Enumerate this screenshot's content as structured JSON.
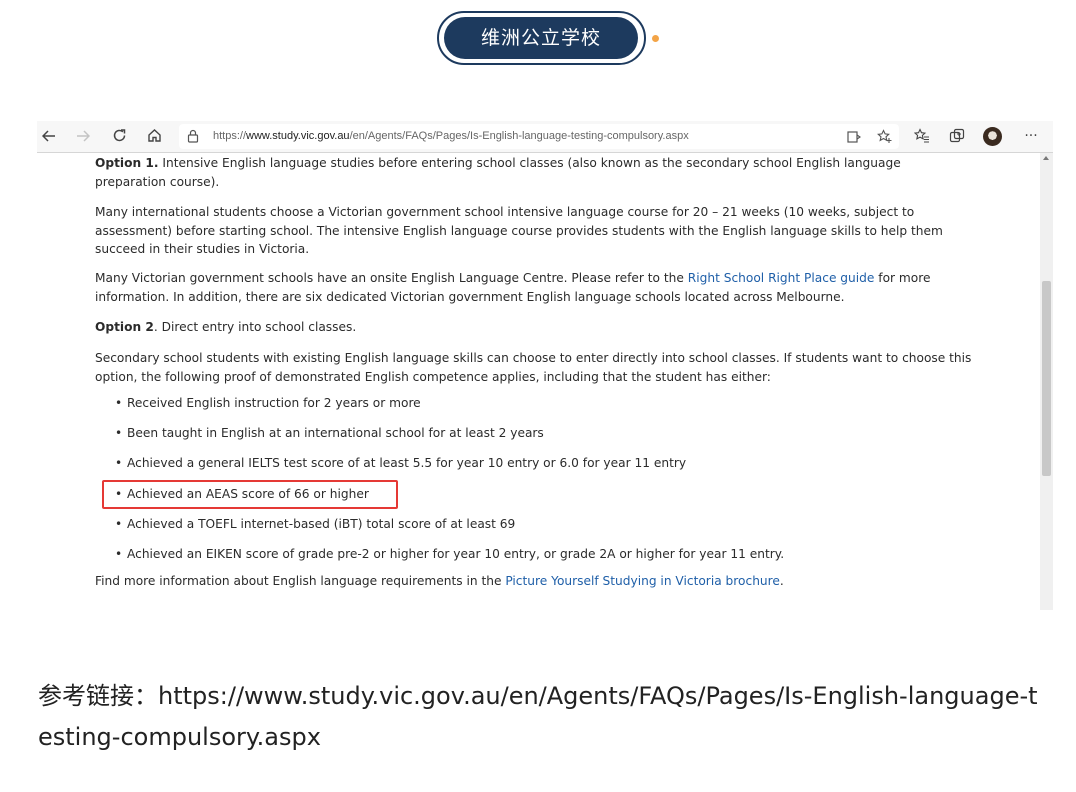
{
  "header": {
    "badge_label": "维洲公立学校",
    "accent_color": "#1d3a5e",
    "dot_color": "#f3a447"
  },
  "browser": {
    "url_prefix": "https://",
    "url_host": "www.study.vic.gov.au",
    "url_path": "/en/Agents/FAQs/Pages/Is-English-language-testing-compulsory.aspx",
    "toolbar_icons": [
      "back-icon",
      "forward-icon",
      "refresh-icon",
      "home-icon",
      "lock-icon",
      "reader-icon",
      "favorite-add-icon",
      "favorites-icon",
      "collections-icon",
      "profile-avatar",
      "more-icon"
    ]
  },
  "page": {
    "option1_label": "Option 1.",
    "option1_text": " Intensive English language studies before entering school classes (also known as the secondary school English language preparation course).",
    "para1": "Many international students choose a Victorian government school intensive language course for 20 – 21 weeks (10 weeks, subject to assessment) before starting school. The intensive English language course provides students with the English language skills to help them succeed in their studies in Victoria.",
    "para2_a": "Many Victorian government schools have an onsite English Language Centre. Please refer to the ",
    "para2_link": "Right School Right Place guide",
    "para2_b": " for more information. In addition, there are six dedicated Victorian government English language schools located across Melbourne.",
    "option2_label": "Option 2",
    "option2_text": ". Direct entry into school classes.",
    "para3": "Secondary school students with existing English language skills can choose to enter directly into school classes. If students want to choose this option, the following proof of demonstrated English competence applies, including that the student has either:",
    "bullets": [
      "Received English instruction for 2 years or more",
      "Been taught in English at an international school for at least 2 years",
      "Achieved a general IELTS test score of at least 5.5 for year 10 entry or 6.0 for year 11 entry",
      "Achieved an AEAS score of 66 or higher",
      "Achieved a TOEFL internet-based (iBT) total score of at least 69",
      "Achieved an EIKEN score of grade pre-2 or higher for year 10 entry, or grade 2A or higher for year 11 entry."
    ],
    "footer_a": "Find more information about English language requirements in the ",
    "footer_link": "Picture Yourself Studying in Victoria brochure",
    "footer_b": "."
  },
  "reference": {
    "label": "参考链接：",
    "url": "https://www.study.vic.gov.au/en/Agents/FAQs/Pages/Is-English-language-testing-compulsory.aspx"
  }
}
